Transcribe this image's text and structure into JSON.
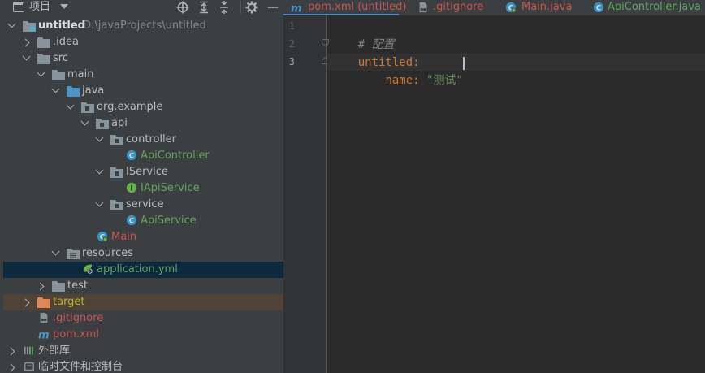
{
  "project_panel": {
    "title": "项目",
    "toolbar_icons": [
      "crosshair-icon",
      "expand-all-icon",
      "collapse-all-icon",
      "gear-icon",
      "minimize-icon"
    ],
    "tree": [
      {
        "label": "untitled",
        "sub": "D:\\javaProjects\\untitled",
        "icon": "module-folder-icon",
        "chevron": "down",
        "color": "#dcdcdc"
      },
      {
        "label": ".idea",
        "icon": "folder-icon",
        "chevron": "right",
        "color": "#bbbbbb"
      },
      {
        "label": "src",
        "icon": "folder-icon",
        "chevron": "down",
        "color": "#bbbbbb"
      },
      {
        "label": "main",
        "icon": "folder-icon",
        "chevron": "down",
        "color": "#bbbbbb"
      },
      {
        "label": "java",
        "icon": "source-folder-icon",
        "chevron": "down",
        "color": "#bbbbbb"
      },
      {
        "label": "org.example",
        "icon": "package-icon",
        "chevron": "down",
        "color": "#bbbbbb"
      },
      {
        "label": "api",
        "icon": "package-icon",
        "chevron": "down",
        "color": "#bbbbbb"
      },
      {
        "label": "controller",
        "icon": "package-icon",
        "chevron": "down",
        "color": "#bbbbbb"
      },
      {
        "label": "ApiController",
        "icon": "class-icon",
        "chevron": "none",
        "color": "#62a362"
      },
      {
        "label": "IService",
        "icon": "package-icon",
        "chevron": "down",
        "color": "#bbbbbb"
      },
      {
        "label": "IApiService",
        "icon": "interface-icon",
        "chevron": "none",
        "color": "#62a362"
      },
      {
        "label": "service",
        "icon": "package-icon",
        "chevron": "down",
        "color": "#bbbbbb"
      },
      {
        "label": "ApiService",
        "icon": "class-icon",
        "chevron": "none",
        "color": "#62a362"
      },
      {
        "label": "Main",
        "icon": "spring-class-icon",
        "chevron": "none",
        "color": "#c75450"
      },
      {
        "label": "resources",
        "icon": "resources-folder-icon",
        "chevron": "down",
        "color": "#bbbbbb"
      },
      {
        "label": "application.yml",
        "icon": "yaml-spring-icon",
        "chevron": "none",
        "color": "#62a362"
      },
      {
        "label": "test",
        "icon": "folder-icon",
        "chevron": "right",
        "color": "#bbbbbb"
      },
      {
        "label": "target",
        "icon": "excluded-folder-icon",
        "chevron": "right",
        "color": "#bbb529"
      },
      {
        "label": ".gitignore",
        "icon": "gitignore-icon",
        "chevron": "none",
        "color": "#c75450"
      },
      {
        "label": "pom.xml",
        "icon": "maven-icon",
        "chevron": "none",
        "color": "#c75450"
      },
      {
        "label": "外部库",
        "icon": "libraries-icon",
        "chevron": "right",
        "color": "#bbbbbb"
      },
      {
        "label": "临时文件和控制台",
        "icon": "scratches-icon",
        "chevron": "right",
        "color": "#bbbbbb"
      }
    ]
  },
  "editor": {
    "tabs": [
      {
        "label": "pom.xml (untitled)",
        "icon": "maven-icon",
        "color": "#c75450"
      },
      {
        "label": ".gitignore",
        "icon": "gitignore-icon",
        "color": "#c75450"
      },
      {
        "label": "Main.java",
        "icon": "spring-class-icon",
        "color": "#c75450"
      },
      {
        "label": "ApiController.java",
        "icon": "class-icon",
        "color": "#62a362"
      }
    ],
    "line_numbers": [
      "1",
      "2",
      "3"
    ],
    "code": {
      "line1_comment": "# 配置",
      "line2_key": "untitled",
      "line2_colon": ":",
      "line3_indent": "    ",
      "line3_key": "name",
      "line3_colon": ":",
      "line3_space": " ",
      "line3_value": "\"测试\""
    }
  }
}
